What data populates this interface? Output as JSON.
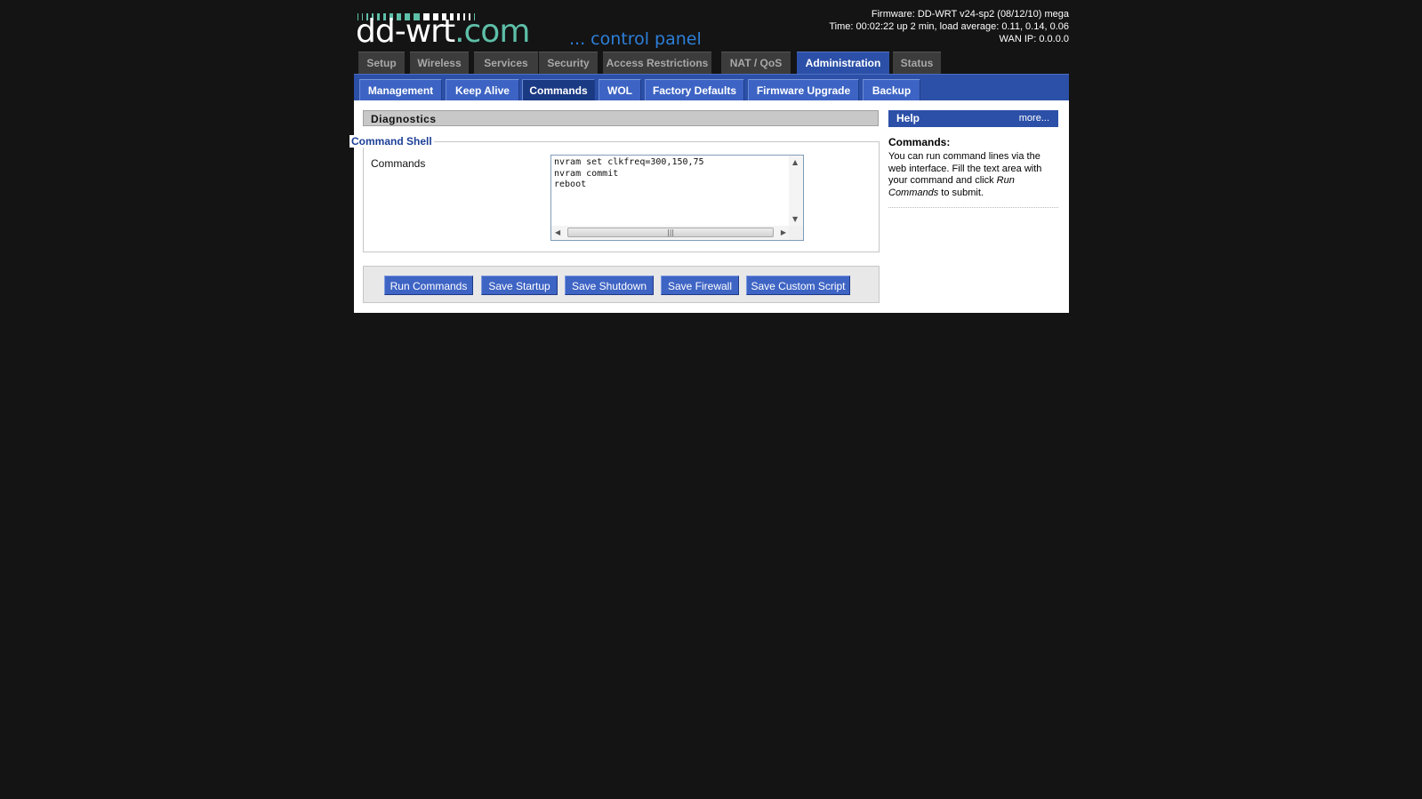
{
  "logo": {
    "main_text": "dd-wrt",
    "tld_text": ".com",
    "tagline": "... control panel"
  },
  "status": {
    "firmware": "Firmware: DD-WRT v24-sp2 (08/12/10) mega",
    "time": "Time: 00:02:22 up 2 min, load average: 0.11, 0.14, 0.06",
    "wan_ip": "WAN IP: 0.0.0.0"
  },
  "main_tabs": [
    {
      "label": "Setup"
    },
    {
      "label": "Wireless"
    },
    {
      "label": "Services"
    },
    {
      "label": "Security"
    },
    {
      "label": "Access Restrictions"
    },
    {
      "label": "NAT / QoS"
    },
    {
      "label": "Administration",
      "active": true
    },
    {
      "label": "Status"
    }
  ],
  "sub_tabs": [
    {
      "label": "Management"
    },
    {
      "label": "Keep Alive"
    },
    {
      "label": "Commands",
      "active": true
    },
    {
      "label": "WOL"
    },
    {
      "label": "Factory Defaults"
    },
    {
      "label": "Firmware Upgrade"
    },
    {
      "label": "Backup"
    }
  ],
  "diagnostics": {
    "header": "Diagnostics",
    "legend": "Command Shell",
    "commands_label": "Commands",
    "commands_value": "nvram set clkfreq=300,150,75\nnvram commit\nreboot"
  },
  "buttons": {
    "run": "Run Commands",
    "save_startup": "Save Startup",
    "save_shutdown": "Save Shutdown",
    "save_firewall": "Save Firewall",
    "save_custom": "Save Custom Script"
  },
  "help": {
    "header": "Help",
    "more": "more...",
    "heading": "Commands:",
    "body_1": "You can run command lines via the web interface. Fill the text area with your command and click ",
    "body_em": "Run Commands",
    "body_2": " to submit."
  },
  "colors": {
    "accent_blue": "#2c50a8",
    "logo_teal": "#5ebfa8",
    "tagline_blue": "#2d7fd8",
    "background": "#141414"
  }
}
